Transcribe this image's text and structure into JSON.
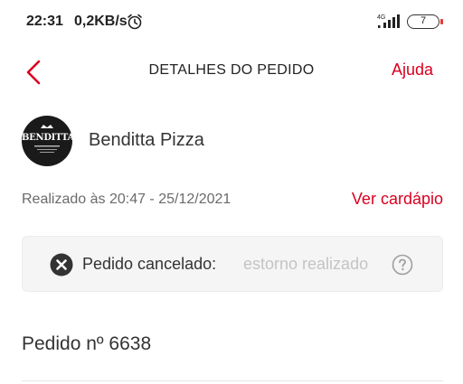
{
  "status_bar": {
    "time": "22:31",
    "network_speed": "0,2KB/s",
    "network_type": "4G",
    "battery_level": "7",
    "icons": [
      "alarm-icon",
      "signal-icon",
      "battery-icon"
    ]
  },
  "nav": {
    "title": "DETALHES DO PEDIDO",
    "help_label": "Ajuda",
    "back_icon": "chevron-left-icon",
    "accent_color": "#d9001f"
  },
  "restaurant": {
    "name": "Benditta Pizza",
    "logo_text": "BENDITTA"
  },
  "order": {
    "placed_at": "Realizado às 20:47 - 25/12/2021",
    "menu_link": "Ver cardápio",
    "status_label": "Pedido cancelado:",
    "status_detail": "estorno realizado",
    "status_icon": "cancel-circle-icon",
    "help_icon": "question-circle-icon",
    "number_label": "Pedido nº 6638"
  }
}
